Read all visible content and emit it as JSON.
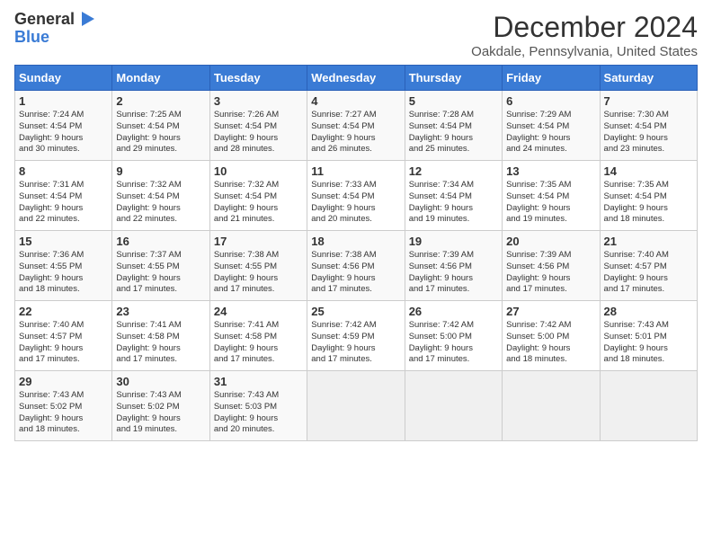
{
  "logo": {
    "part1": "General",
    "part2": "Blue"
  },
  "title": "December 2024",
  "location": "Oakdale, Pennsylvania, United States",
  "days_of_week": [
    "Sunday",
    "Monday",
    "Tuesday",
    "Wednesday",
    "Thursday",
    "Friday",
    "Saturday"
  ],
  "weeks": [
    [
      {
        "day": 1,
        "info": "Sunrise: 7:24 AM\nSunset: 4:54 PM\nDaylight: 9 hours\nand 30 minutes."
      },
      {
        "day": 2,
        "info": "Sunrise: 7:25 AM\nSunset: 4:54 PM\nDaylight: 9 hours\nand 29 minutes."
      },
      {
        "day": 3,
        "info": "Sunrise: 7:26 AM\nSunset: 4:54 PM\nDaylight: 9 hours\nand 28 minutes."
      },
      {
        "day": 4,
        "info": "Sunrise: 7:27 AM\nSunset: 4:54 PM\nDaylight: 9 hours\nand 26 minutes."
      },
      {
        "day": 5,
        "info": "Sunrise: 7:28 AM\nSunset: 4:54 PM\nDaylight: 9 hours\nand 25 minutes."
      },
      {
        "day": 6,
        "info": "Sunrise: 7:29 AM\nSunset: 4:54 PM\nDaylight: 9 hours\nand 24 minutes."
      },
      {
        "day": 7,
        "info": "Sunrise: 7:30 AM\nSunset: 4:54 PM\nDaylight: 9 hours\nand 23 minutes."
      }
    ],
    [
      {
        "day": 8,
        "info": "Sunrise: 7:31 AM\nSunset: 4:54 PM\nDaylight: 9 hours\nand 22 minutes."
      },
      {
        "day": 9,
        "info": "Sunrise: 7:32 AM\nSunset: 4:54 PM\nDaylight: 9 hours\nand 22 minutes."
      },
      {
        "day": 10,
        "info": "Sunrise: 7:32 AM\nSunset: 4:54 PM\nDaylight: 9 hours\nand 21 minutes."
      },
      {
        "day": 11,
        "info": "Sunrise: 7:33 AM\nSunset: 4:54 PM\nDaylight: 9 hours\nand 20 minutes."
      },
      {
        "day": 12,
        "info": "Sunrise: 7:34 AM\nSunset: 4:54 PM\nDaylight: 9 hours\nand 19 minutes."
      },
      {
        "day": 13,
        "info": "Sunrise: 7:35 AM\nSunset: 4:54 PM\nDaylight: 9 hours\nand 19 minutes."
      },
      {
        "day": 14,
        "info": "Sunrise: 7:35 AM\nSunset: 4:54 PM\nDaylight: 9 hours\nand 18 minutes."
      }
    ],
    [
      {
        "day": 15,
        "info": "Sunrise: 7:36 AM\nSunset: 4:55 PM\nDaylight: 9 hours\nand 18 minutes."
      },
      {
        "day": 16,
        "info": "Sunrise: 7:37 AM\nSunset: 4:55 PM\nDaylight: 9 hours\nand 17 minutes."
      },
      {
        "day": 17,
        "info": "Sunrise: 7:38 AM\nSunset: 4:55 PM\nDaylight: 9 hours\nand 17 minutes."
      },
      {
        "day": 18,
        "info": "Sunrise: 7:38 AM\nSunset: 4:56 PM\nDaylight: 9 hours\nand 17 minutes."
      },
      {
        "day": 19,
        "info": "Sunrise: 7:39 AM\nSunset: 4:56 PM\nDaylight: 9 hours\nand 17 minutes."
      },
      {
        "day": 20,
        "info": "Sunrise: 7:39 AM\nSunset: 4:56 PM\nDaylight: 9 hours\nand 17 minutes."
      },
      {
        "day": 21,
        "info": "Sunrise: 7:40 AM\nSunset: 4:57 PM\nDaylight: 9 hours\nand 17 minutes."
      }
    ],
    [
      {
        "day": 22,
        "info": "Sunrise: 7:40 AM\nSunset: 4:57 PM\nDaylight: 9 hours\nand 17 minutes."
      },
      {
        "day": 23,
        "info": "Sunrise: 7:41 AM\nSunset: 4:58 PM\nDaylight: 9 hours\nand 17 minutes."
      },
      {
        "day": 24,
        "info": "Sunrise: 7:41 AM\nSunset: 4:58 PM\nDaylight: 9 hours\nand 17 minutes."
      },
      {
        "day": 25,
        "info": "Sunrise: 7:42 AM\nSunset: 4:59 PM\nDaylight: 9 hours\nand 17 minutes."
      },
      {
        "day": 26,
        "info": "Sunrise: 7:42 AM\nSunset: 5:00 PM\nDaylight: 9 hours\nand 17 minutes."
      },
      {
        "day": 27,
        "info": "Sunrise: 7:42 AM\nSunset: 5:00 PM\nDaylight: 9 hours\nand 18 minutes."
      },
      {
        "day": 28,
        "info": "Sunrise: 7:43 AM\nSunset: 5:01 PM\nDaylight: 9 hours\nand 18 minutes."
      }
    ],
    [
      {
        "day": 29,
        "info": "Sunrise: 7:43 AM\nSunset: 5:02 PM\nDaylight: 9 hours\nand 18 minutes."
      },
      {
        "day": 30,
        "info": "Sunrise: 7:43 AM\nSunset: 5:02 PM\nDaylight: 9 hours\nand 19 minutes."
      },
      {
        "day": 31,
        "info": "Sunrise: 7:43 AM\nSunset: 5:03 PM\nDaylight: 9 hours\nand 20 minutes."
      },
      null,
      null,
      null,
      null
    ]
  ]
}
